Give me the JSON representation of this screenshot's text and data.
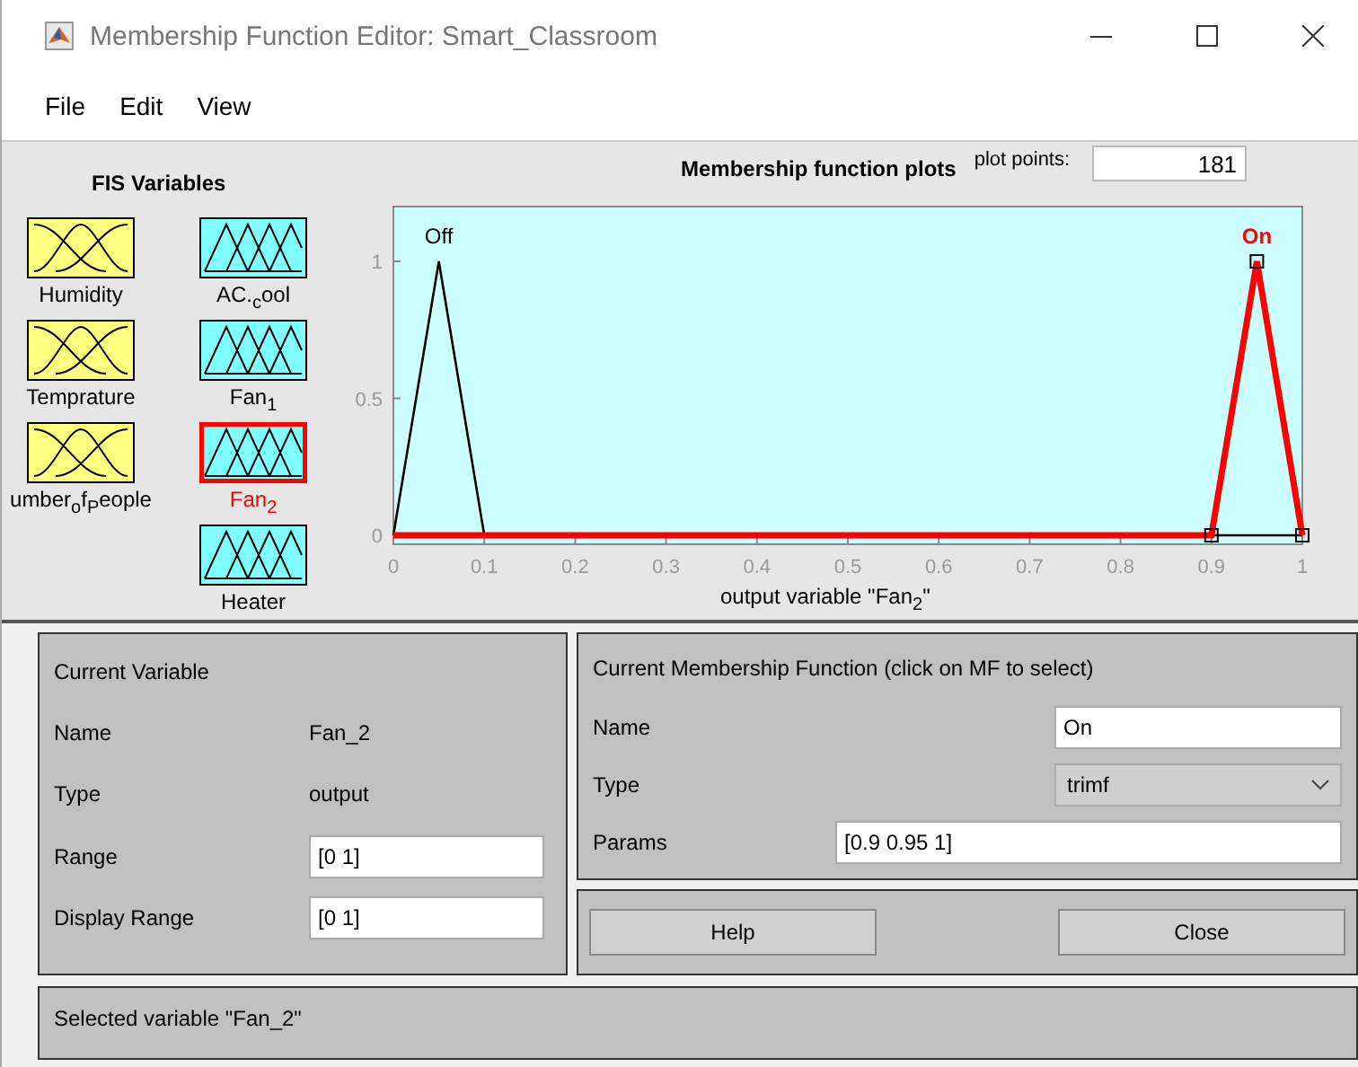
{
  "window": {
    "title": "Membership Function Editor: Smart_Classroom"
  },
  "menu": [
    "File",
    "Edit",
    "View"
  ],
  "fis_variables": {
    "title": "FIS Variables",
    "inputs": [
      {
        "label": "Humidity",
        "selected": false
      },
      {
        "label": "Temprature",
        "selected": false
      },
      {
        "label": "umber$_{o}$f$_{P}$eople",
        "selected": false
      }
    ],
    "outputs": [
      {
        "label": "AC.$_{c}$ool",
        "selected": false
      },
      {
        "label": "Fan$_{1}$",
        "selected": false
      },
      {
        "label": "Fan$_{2}$",
        "selected": true
      },
      {
        "label": "Heater",
        "selected": false
      }
    ]
  },
  "plot": {
    "title": "Membership function plots",
    "plot_points_label": "plot points:",
    "plot_points": "181",
    "chart_data": {
      "type": "line",
      "xlabel": "output variable \"Fan$_{2}$\"",
      "x": [
        0,
        0.05,
        0.1,
        0.9,
        0.95,
        1
      ],
      "xlim": [
        0,
        1
      ],
      "ylim": [
        0,
        1.2
      ],
      "xticks": [
        0,
        0.1,
        0.2,
        0.3,
        0.4,
        0.5,
        0.6,
        0.7,
        0.8,
        0.9,
        1
      ],
      "yticks": [
        0,
        0.5,
        1
      ],
      "series": [
        {
          "name": "Off",
          "color": "#000000",
          "values": [
            0,
            1,
            0,
            0,
            0,
            0
          ]
        },
        {
          "name": "On",
          "color": "#ff0000",
          "values": [
            0,
            0,
            0,
            0,
            1,
            0
          ]
        }
      ]
    }
  },
  "current_variable": {
    "title": "Current Variable",
    "fields": [
      {
        "label": "Name",
        "value": "Fan_2",
        "kind": "text"
      },
      {
        "label": "Type",
        "value": "output",
        "kind": "text"
      },
      {
        "label": "Range",
        "value": "[0 1]",
        "kind": "input"
      },
      {
        "label": "Display Range",
        "value": "[0 1]",
        "kind": "input"
      }
    ]
  },
  "current_mf": {
    "title": "Current Membership Function (click on MF to select)",
    "fields": [
      {
        "label": "Name",
        "value": "On",
        "kind": "input"
      },
      {
        "label": "Type",
        "value": "trimf",
        "kind": "dropdown"
      },
      {
        "label": "Params",
        "value": "[0.9 0.95 1]",
        "kind": "wide"
      }
    ]
  },
  "buttons": [
    "Help",
    "Close"
  ],
  "status": "Selected variable \"Fan_2\""
}
